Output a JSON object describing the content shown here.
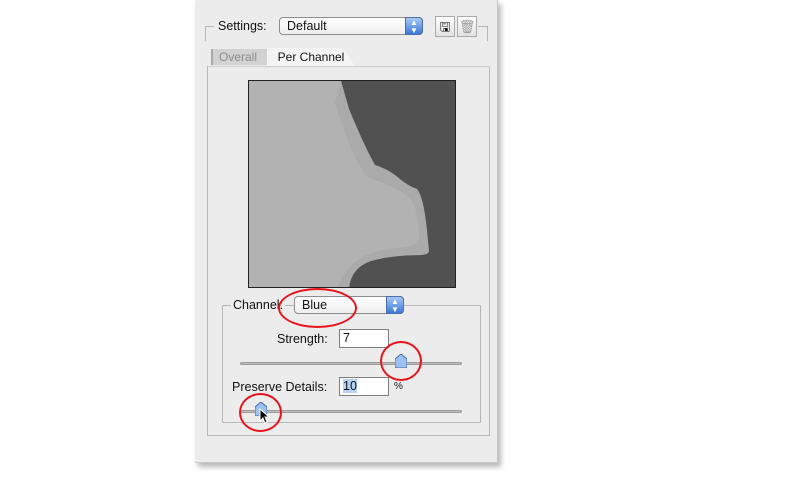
{
  "settings": {
    "label": "Settings:",
    "selected": "Default"
  },
  "tabs": [
    {
      "label": "Overall",
      "active": false
    },
    {
      "label": "Per Channel",
      "active": true
    }
  ],
  "channel": {
    "label": "Channel:",
    "selected": "Blue"
  },
  "strength": {
    "label": "Strength:",
    "value": "7"
  },
  "preserve_details": {
    "label": "Preserve Details:",
    "value": "10",
    "unit": "%"
  },
  "colors": {
    "annotation_circle": "#e8141c",
    "select_arrow": "#3b78d8"
  },
  "icons": [
    "save-preset-icon",
    "trash-icon",
    "up-down-arrows-icon",
    "slider-thumb-icon",
    "mouse-pointer-icon"
  ]
}
